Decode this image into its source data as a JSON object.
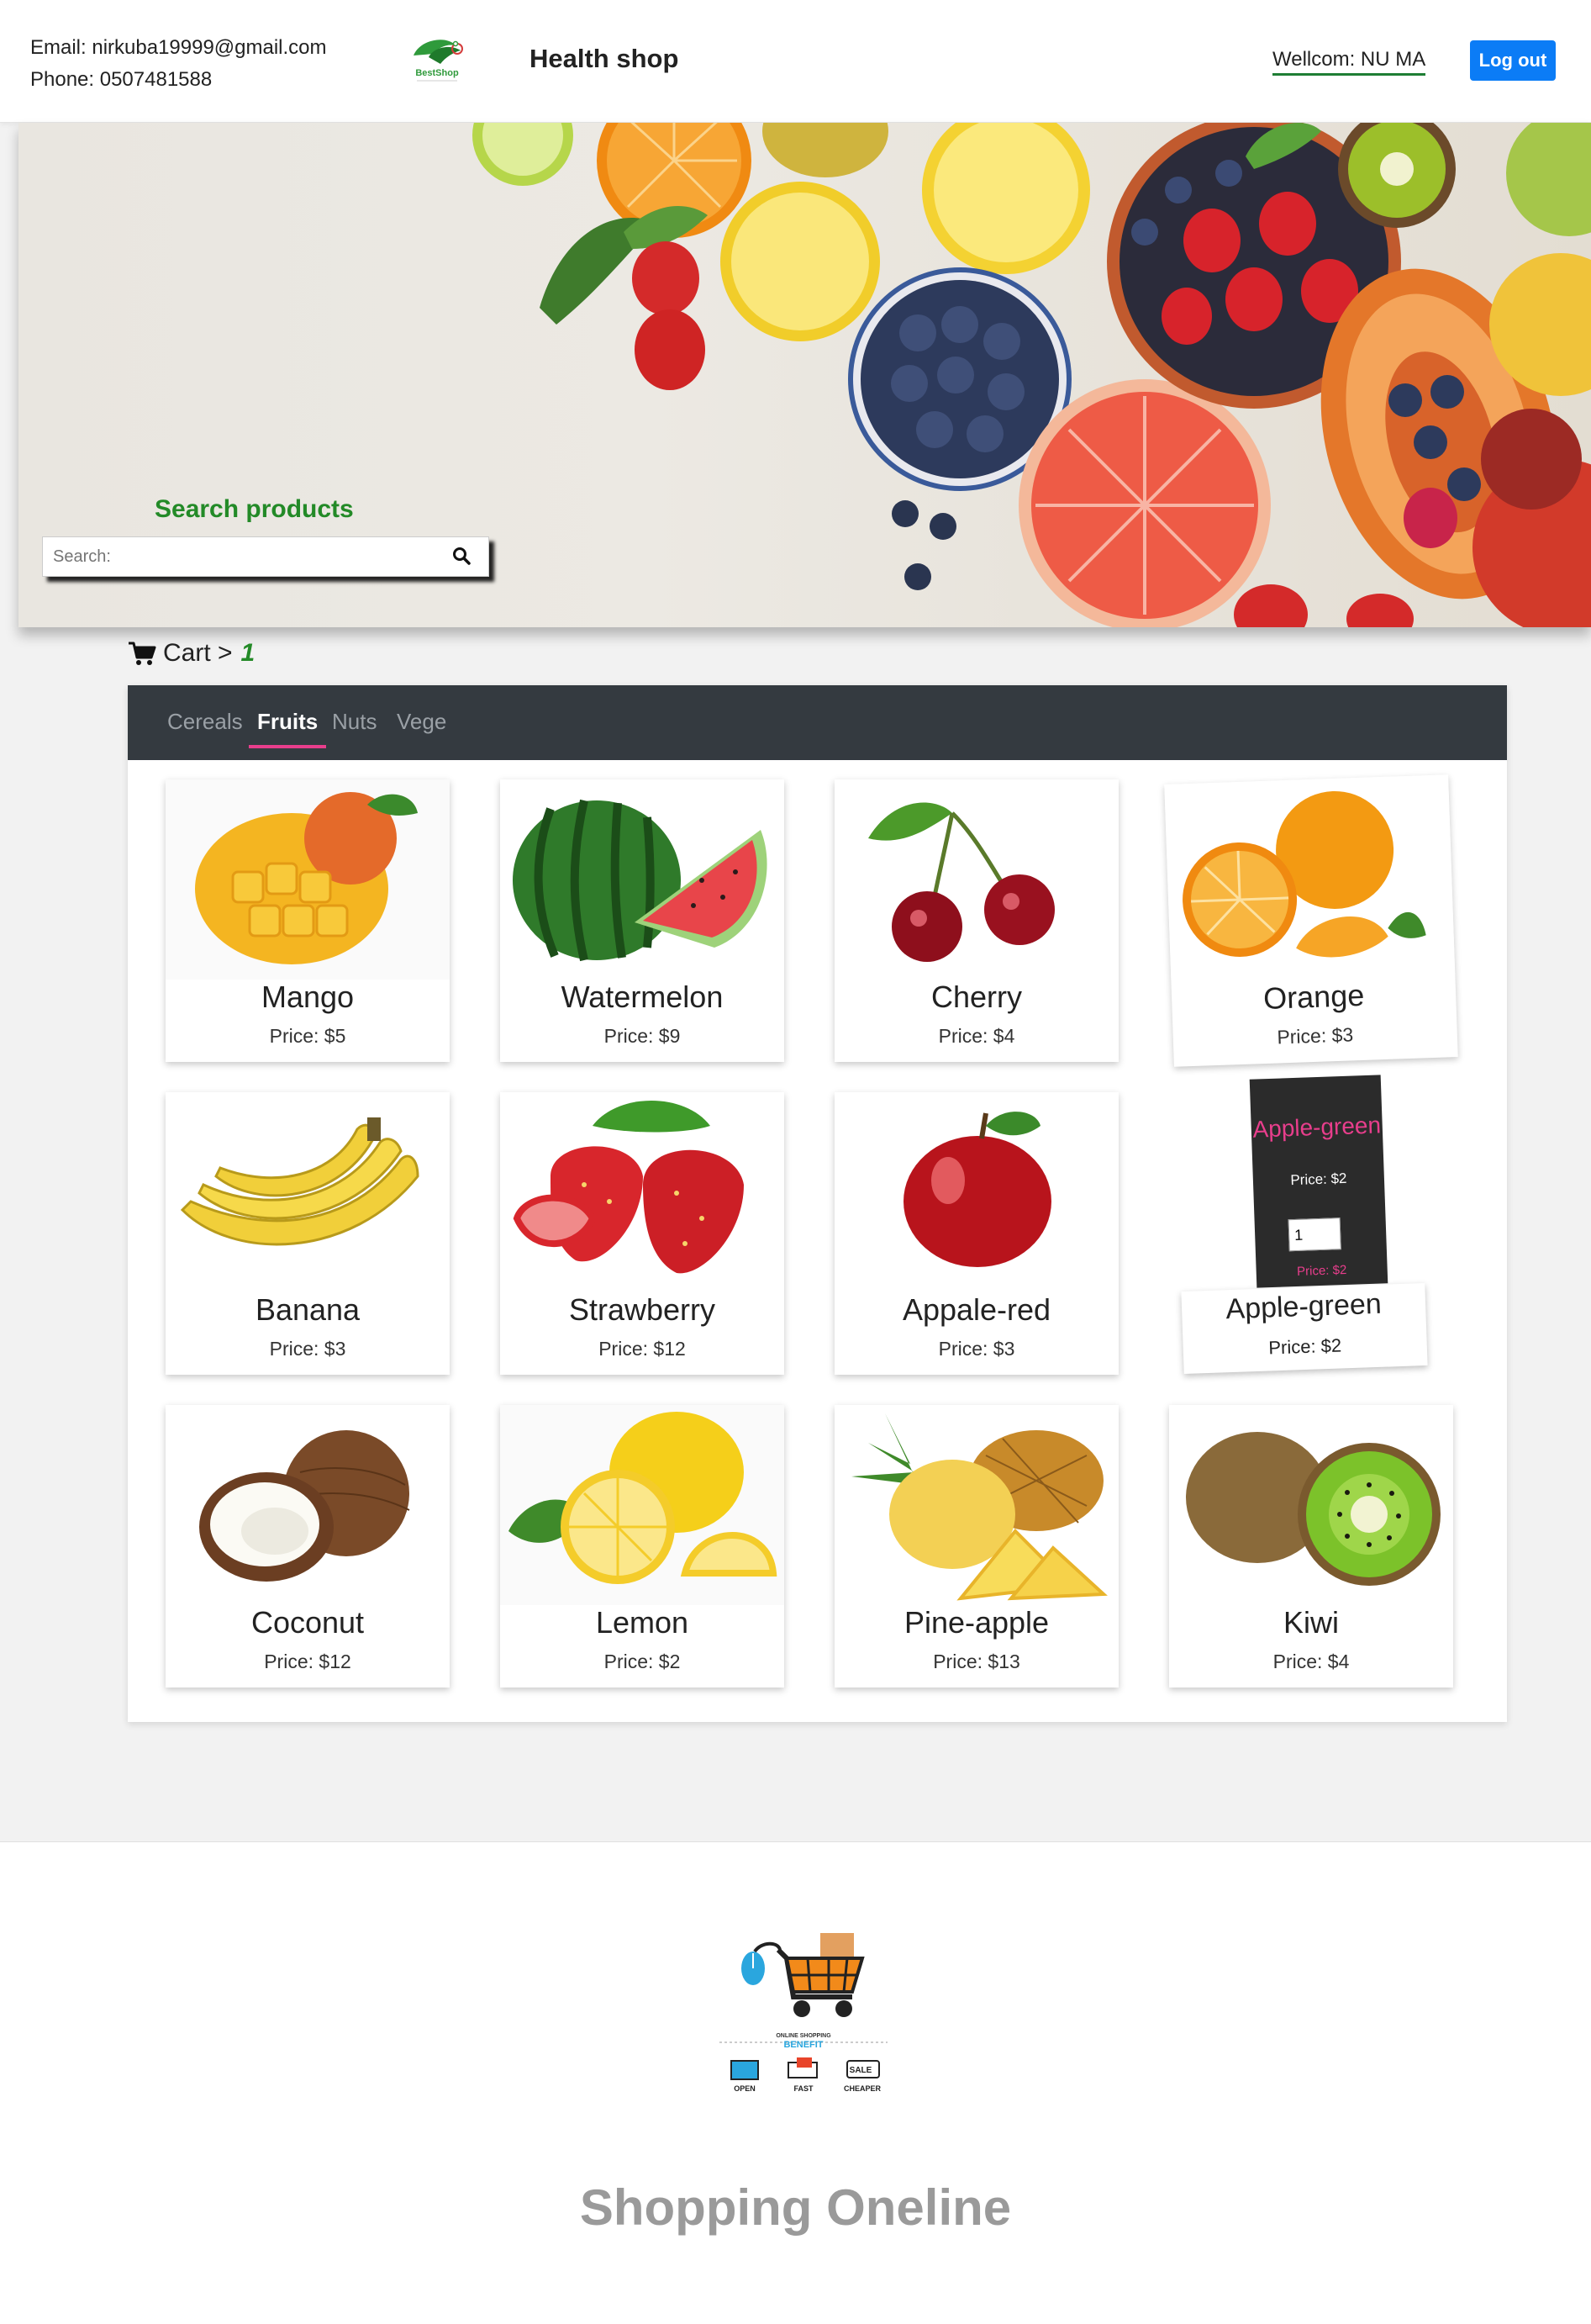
{
  "header": {
    "email": "Email: nirkuba19999@gmail.com",
    "phone": "Phone: 0507481588",
    "logo_text": "BestShop",
    "brand": "Health shop",
    "welcome": "Wellcom: NU MA",
    "logout_label": "Log out"
  },
  "hero": {
    "search_title": "Search products",
    "search_placeholder": "Search:"
  },
  "cart": {
    "label": "Cart >",
    "count": "1"
  },
  "tabs": [
    {
      "label": "Cereals",
      "active": false
    },
    {
      "label": "Fruits",
      "active": true
    },
    {
      "label": "Nuts",
      "active": false
    },
    {
      "label": "Vege",
      "active": false
    }
  ],
  "products": [
    {
      "name": "Mango",
      "price": "Price: $5"
    },
    {
      "name": "Watermelon",
      "price": "Price: $9"
    },
    {
      "name": "Cherry",
      "price": "Price: $4"
    },
    {
      "name": "Orange",
      "price": "Price: $3"
    },
    {
      "name": "Banana",
      "price": "Price: $3"
    },
    {
      "name": "Strawberry",
      "price": "Price: $12"
    },
    {
      "name": "Appale-red",
      "price": "Price: $3"
    },
    {
      "name": "Apple-green",
      "price": "Price: $2"
    },
    {
      "name": "Coconut",
      "price": "Price: $12"
    },
    {
      "name": "Lemon",
      "price": "Price: $2"
    },
    {
      "name": "Pine-apple",
      "price": "Price: $13"
    },
    {
      "name": "Kiwi",
      "price": "Price: $4"
    }
  ],
  "hover_card": {
    "name": "Apple-green",
    "price": "Price: $2",
    "quantity": "1",
    "price_repeat": "Price: $2"
  },
  "footer": {
    "logo_caption": "ONLINE SHOPPING",
    "logo_benefit": "BENEFIT",
    "logo_items": [
      "OPEN",
      "FAST",
      "CHEAPER"
    ],
    "logo_sale": "SALE",
    "title": "Shopping Oneline"
  },
  "colors": {
    "accent_green": "#238a27",
    "logout_blue": "#0b7cf6",
    "tab_bar": "#343a40",
    "tab_active_underline": "#e83e8c"
  }
}
